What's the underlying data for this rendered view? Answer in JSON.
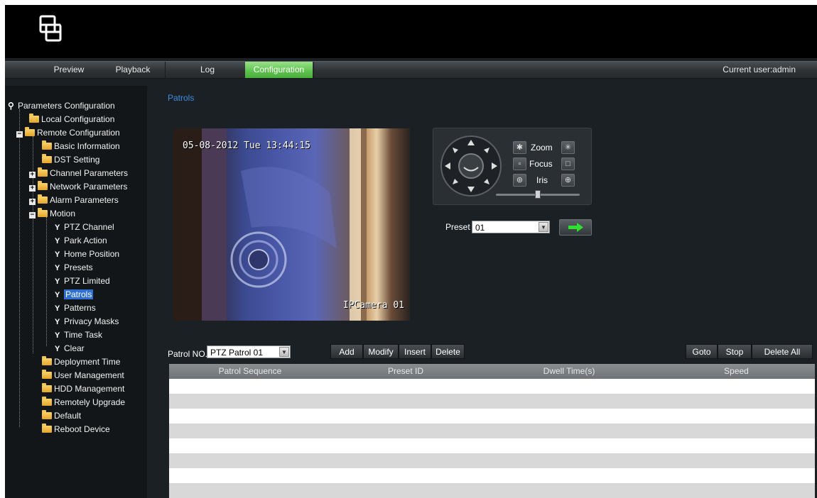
{
  "nav": {
    "items": [
      "Preview",
      "Playback",
      "Log",
      "Configuration"
    ],
    "active": "Configuration",
    "current_user": "Current user:admin"
  },
  "tree": {
    "root": "Parameters Configuration",
    "items": [
      "Local Configuration",
      "Remote Configuration",
      "Basic Information",
      "DST Setting",
      "Channel Parameters",
      "Network Parameters",
      "Alarm Parameters",
      "Motion",
      "PTZ Channel",
      "Park Action",
      "Home Position",
      "Presets",
      "PTZ Limited",
      "Patrols",
      "Patterns",
      "Privacy Masks",
      "Time Task",
      "Clear",
      "Deployment Time",
      "User Management",
      "HDD Management",
      "Remotely Upgrade",
      "Default",
      "Reboot Device"
    ],
    "selected": "Patrols"
  },
  "page": {
    "title": "Patrols"
  },
  "video": {
    "timestamp": "05-08-2012 Tue 13:44:15",
    "camera_name": "IPCamera 01"
  },
  "ptz": {
    "zoom_label": "Zoom",
    "focus_label": "Focus",
    "iris_label": "Iris",
    "speed_level": 0.5
  },
  "preset": {
    "label": "Preset",
    "value": "01"
  },
  "patrol": {
    "label": "Patrol NO.",
    "value": "PTZ Patrol 01",
    "buttons": {
      "add": "Add",
      "modify": "Modify",
      "insert": "Insert",
      "delete": "Delete",
      "goto": "Goto",
      "stop": "Stop",
      "delete_all": "Delete All"
    }
  },
  "table": {
    "columns": [
      "Patrol Sequence",
      "Preset ID",
      "Dwell Time(s)",
      "Speed"
    ],
    "rows": []
  }
}
